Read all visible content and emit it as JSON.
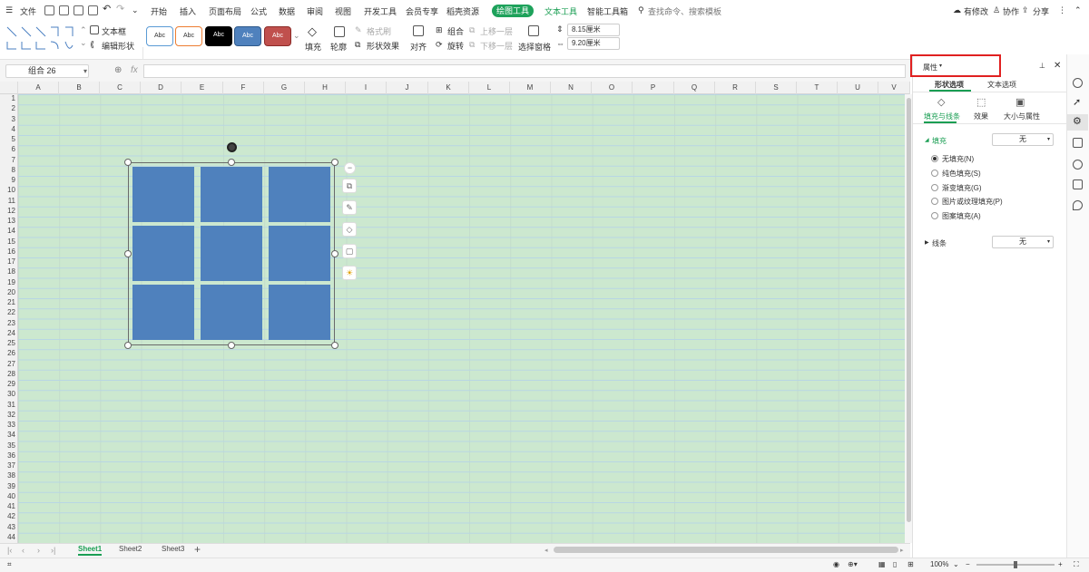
{
  "menu": {
    "file": "文件",
    "tabs": [
      "开始",
      "插入",
      "页面布局",
      "公式",
      "数据",
      "审阅",
      "视图",
      "开发工具",
      "会员专享",
      "稻壳资源"
    ],
    "active_tab": "绘图工具",
    "text_tools": "文本工具",
    "smart_tools": "智能工具箱",
    "search_placeholder": "查找命令、搜索模板",
    "right": [
      "有修改",
      "协作",
      "分享"
    ]
  },
  "ribbon": {
    "textbox": "文本框",
    "edit_shape": "编辑形状",
    "styles": [
      "Abc",
      "Abc",
      "Abc",
      "Abc",
      "Abc"
    ],
    "style_colors": {
      "outline_blue": "#5b9bd5",
      "outline_orange": "#ed7d31",
      "black": "#000000",
      "blue": "#4f81bd",
      "red": "#c0504d"
    },
    "fill": "填充",
    "outline": "轮廓",
    "format_painter": "格式刷",
    "shape_effects": "形状效果",
    "align": "对齐",
    "group": "组合",
    "rotate": "旋转",
    "bring_forward": "上移一层",
    "send_backward": "下移一层",
    "selection_pane": "选择窗格",
    "height": "8.15厘米",
    "width": "9.20厘米"
  },
  "formula_bar": {
    "name_box": "组合 26",
    "fx": "fx"
  },
  "columns": [
    "A",
    "B",
    "C",
    "D",
    "E",
    "F",
    "G",
    "H",
    "I",
    "J",
    "K",
    "L",
    "M",
    "N",
    "O",
    "P",
    "Q",
    "R",
    "S",
    "T",
    "U",
    "V"
  ],
  "rows": [
    "1",
    "2",
    "3",
    "4",
    "5",
    "6",
    "7",
    "8",
    "9",
    "10",
    "11",
    "12",
    "13",
    "14",
    "15",
    "16",
    "17",
    "18",
    "19",
    "20",
    "21",
    "22",
    "23",
    "24",
    "25",
    "26",
    "27",
    "28",
    "29",
    "30",
    "31",
    "32",
    "33",
    "34",
    "35",
    "36",
    "37",
    "38",
    "39",
    "40",
    "41",
    "42",
    "43",
    "44"
  ],
  "sheets": [
    "Sheet1",
    "Sheet2",
    "Sheet3"
  ],
  "active_sheet": "Sheet1",
  "status": {
    "zoom": "100%"
  },
  "panel": {
    "title": "属性",
    "tab_shape": "形状选项",
    "tab_text": "文本选项",
    "sub_fill_line": "填充与线条",
    "sub_effects": "效果",
    "sub_size": "大小与属性",
    "fill_label": "填充",
    "fill_value": "无",
    "fill_options": [
      "无填充(N)",
      "纯色填充(S)",
      "渐变填充(G)",
      "图片或纹理填充(P)",
      "图案填充(A)"
    ],
    "line_label": "线条",
    "line_value": "无"
  },
  "colors": {
    "accent": "#1ea25b",
    "shape_fill": "#4f81bd",
    "sheet_bg": "#cce8cf",
    "highlight": "#e02020"
  }
}
